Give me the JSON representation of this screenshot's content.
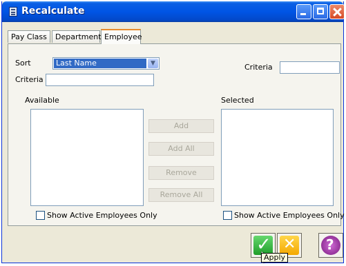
{
  "window": {
    "title": "Recalculate"
  },
  "tabs": [
    {
      "label": "Pay Class"
    },
    {
      "label": "Department"
    },
    {
      "label": "Employee"
    }
  ],
  "form": {
    "sort_label": "Sort",
    "sort_value": "Last Name",
    "criteria_label_left": "Criteria",
    "criteria_value_left": "",
    "criteria_label_right": "Criteria",
    "criteria_value_right": "",
    "available_label": "Available",
    "selected_label": "Selected",
    "available_items": [],
    "selected_items": []
  },
  "buttons": {
    "add": "Add",
    "add_all": "Add All",
    "remove": "Remove",
    "remove_all": "Remove All"
  },
  "checkboxes": {
    "left": {
      "label": "Show Active Employees Only",
      "checked": false
    },
    "right": {
      "label": "Show Active Employees Only",
      "checked": false
    }
  },
  "toolbar": {
    "ok_icon": "green-check-icon",
    "cancel_icon": "yellow-x-icon",
    "help_icon": "purple-question-icon"
  },
  "tooltip": {
    "text": "Apply"
  },
  "colors": {
    "title_blue": "#0055e5",
    "selection": "#316ac5",
    "dialog_bg": "#ece9d8"
  }
}
